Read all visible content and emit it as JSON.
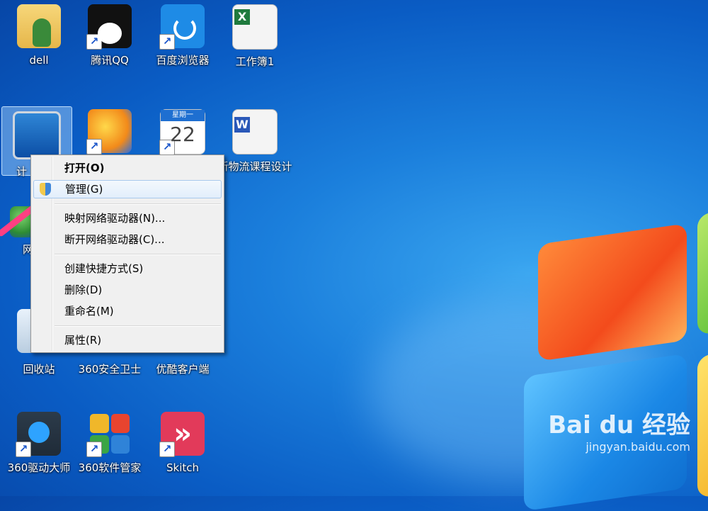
{
  "desktop": {
    "icons": [
      {
        "name": "dell",
        "label": "dell"
      },
      {
        "name": "qq",
        "label": "腾讯QQ"
      },
      {
        "name": "baidu-browser",
        "label": "百度浏览器"
      },
      {
        "name": "workbook1",
        "label": "工作簿1"
      },
      {
        "name": "computer",
        "label": "计"
      },
      {
        "name": "360se",
        "label": ""
      },
      {
        "name": "calendar",
        "label": ""
      },
      {
        "name": "word-doc",
        "label": "新物流课程设计"
      },
      {
        "name": "network",
        "label": "网"
      },
      {
        "name": "recycle-bin",
        "label": "回收站"
      },
      {
        "name": "360safe",
        "label": "360安全卫士"
      },
      {
        "name": "youku",
        "label": "优酷客户端"
      },
      {
        "name": "360driver",
        "label": "360驱动大师"
      },
      {
        "name": "360software",
        "label": "360软件管家"
      },
      {
        "name": "skitch",
        "label": "Skitch"
      }
    ]
  },
  "context_menu": {
    "open": "打开(O)",
    "manage": "管理(G)",
    "map_drive": "映射网络驱动器(N)...",
    "disconnect_drive": "断开网络驱动器(C)...",
    "create_shortcut": "创建快捷方式(S)",
    "delete": "删除(D)",
    "rename": "重命名(M)",
    "properties": "属性(R)"
  },
  "watermark": {
    "brand": "Bai du 经验",
    "url": "jingyan.baidu.com"
  },
  "colors": {
    "annotation_stroke": "#ff3f82",
    "wallpaper_blue": "#1b7fdc"
  }
}
